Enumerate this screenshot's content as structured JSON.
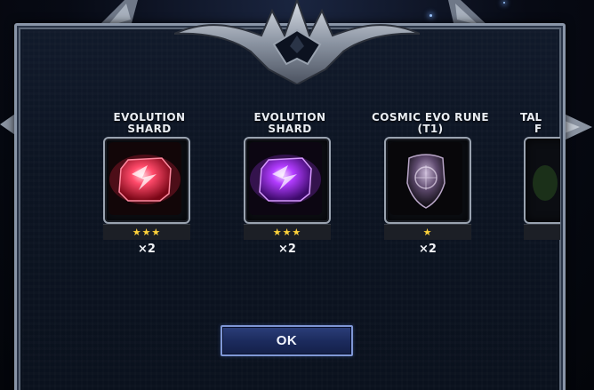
{
  "dialog": {
    "rewards": [
      {
        "title_line1": "EVOLUTION SHARD",
        "title_line2": "",
        "stars": "★★★",
        "star_count": 3,
        "quantity": "×2",
        "icon": "red-evolution-shard-icon",
        "color": "#ff2f4a"
      },
      {
        "title_line1": "EVOLUTION SHARD",
        "title_line2": "",
        "stars": "★★★",
        "star_count": 3,
        "quantity": "×2",
        "icon": "purple-evolution-shard-icon",
        "color": "#b23cff"
      },
      {
        "title_line1": "COSMIC EVO RUNE",
        "title_line2": "(T1)",
        "stars": "★",
        "star_count": 1,
        "quantity": "×2",
        "icon": "cosmic-evo-rune-icon",
        "color": "#7a5a8a"
      },
      {
        "title_line1": "TAL",
        "title_line2": "F",
        "stars": "",
        "star_count": 0,
        "quantity": "",
        "icon": "partial-reward-icon",
        "color": "#2e5a2a"
      }
    ],
    "ok_label": "OK"
  },
  "theme": {
    "panel_border": "#8a96a8",
    "button_fill": "#1c2b5e",
    "star_color": "#ffd23a"
  }
}
